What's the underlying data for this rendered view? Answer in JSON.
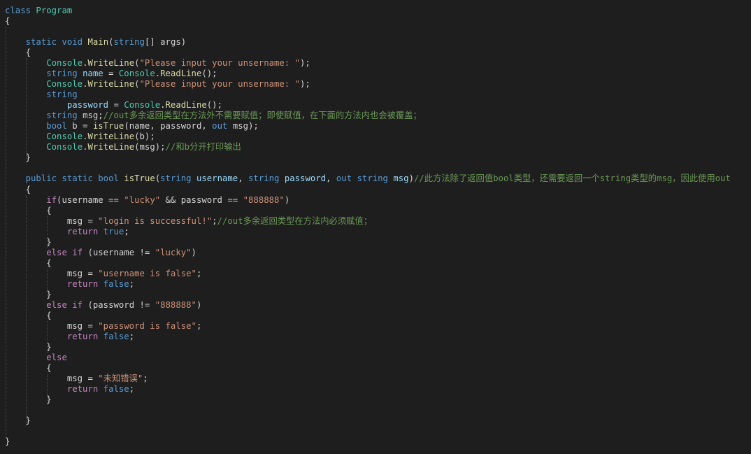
{
  "theme": {
    "background": "#1e1e1e",
    "keyword": "#569cd6",
    "control": "#c586c0",
    "type": "#4ec9b0",
    "method": "#dcdcaa",
    "string": "#ce9178",
    "variable": "#9cdcfe",
    "comment": "#6a9955",
    "plain": "#d4d4d4"
  },
  "code": {
    "lines": [
      {
        "tokens": [
          {
            "t": "class ",
            "c": "kw"
          },
          {
            "t": "Program",
            "c": "ty"
          }
        ]
      },
      {
        "tokens": [
          {
            "t": "{",
            "c": "pl"
          }
        ]
      },
      {
        "tokens": []
      },
      {
        "tokens": [
          {
            "t": "    ",
            "c": "pl"
          },
          {
            "t": "static ",
            "c": "kw"
          },
          {
            "t": "void ",
            "c": "kw"
          },
          {
            "t": "Main",
            "c": "mt"
          },
          {
            "t": "(",
            "c": "pl"
          },
          {
            "t": "string",
            "c": "kw"
          },
          {
            "t": "[] ",
            "c": "pl"
          },
          {
            "t": "args",
            "c": "pl"
          },
          {
            "t": ")",
            "c": "pl"
          }
        ]
      },
      {
        "tokens": [
          {
            "t": "    {",
            "c": "pl"
          }
        ]
      },
      {
        "tokens": [
          {
            "t": "        ",
            "c": "pl"
          },
          {
            "t": "Console",
            "c": "ty"
          },
          {
            "t": ".",
            "c": "pl"
          },
          {
            "t": "WriteLine",
            "c": "mt"
          },
          {
            "t": "(",
            "c": "pl"
          },
          {
            "t": "\"Please input your unsername: \"",
            "c": "st"
          },
          {
            "t": ");",
            "c": "pl"
          }
        ]
      },
      {
        "tokens": [
          {
            "t": "        ",
            "c": "pl"
          },
          {
            "t": "string ",
            "c": "kw"
          },
          {
            "t": "name",
            "c": "va"
          },
          {
            "t": " = ",
            "c": "pl"
          },
          {
            "t": "Console",
            "c": "ty"
          },
          {
            "t": ".",
            "c": "pl"
          },
          {
            "t": "ReadLine",
            "c": "mt"
          },
          {
            "t": "();",
            "c": "pl"
          }
        ]
      },
      {
        "tokens": [
          {
            "t": "        ",
            "c": "pl"
          },
          {
            "t": "Console",
            "c": "ty"
          },
          {
            "t": ".",
            "c": "pl"
          },
          {
            "t": "WriteLine",
            "c": "mt"
          },
          {
            "t": "(",
            "c": "pl"
          },
          {
            "t": "\"Please input your unsername: \"",
            "c": "st"
          },
          {
            "t": ");",
            "c": "pl"
          }
        ]
      },
      {
        "tokens": [
          {
            "t": "        ",
            "c": "pl"
          },
          {
            "t": "string",
            "c": "kw"
          }
        ]
      },
      {
        "tokens": [
          {
            "t": "            ",
            "c": "pl"
          },
          {
            "t": "password",
            "c": "va"
          },
          {
            "t": " = ",
            "c": "pl"
          },
          {
            "t": "Console",
            "c": "ty"
          },
          {
            "t": ".",
            "c": "pl"
          },
          {
            "t": "ReadLine",
            "c": "mt"
          },
          {
            "t": "();",
            "c": "pl"
          }
        ]
      },
      {
        "tokens": [
          {
            "t": "        ",
            "c": "pl"
          },
          {
            "t": "string ",
            "c": "kw"
          },
          {
            "t": "msg;",
            "c": "pl"
          },
          {
            "t": "//out多余返回类型在方法外不需要赋值；即使赋值，在下面的方法内也会被覆盖；",
            "c": "cm"
          }
        ]
      },
      {
        "tokens": [
          {
            "t": "        ",
            "c": "pl"
          },
          {
            "t": "bool ",
            "c": "kw"
          },
          {
            "t": "b = ",
            "c": "pl"
          },
          {
            "t": "isTrue",
            "c": "mt"
          },
          {
            "t": "(name, password, ",
            "c": "pl"
          },
          {
            "t": "out ",
            "c": "kw"
          },
          {
            "t": "msg);",
            "c": "pl"
          }
        ]
      },
      {
        "tokens": [
          {
            "t": "        ",
            "c": "pl"
          },
          {
            "t": "Console",
            "c": "ty"
          },
          {
            "t": ".",
            "c": "pl"
          },
          {
            "t": "WriteLine",
            "c": "mt"
          },
          {
            "t": "(b);",
            "c": "pl"
          }
        ]
      },
      {
        "tokens": [
          {
            "t": "        ",
            "c": "pl"
          },
          {
            "t": "Console",
            "c": "ty"
          },
          {
            "t": ".",
            "c": "pl"
          },
          {
            "t": "WriteLine",
            "c": "mt"
          },
          {
            "t": "(msg);",
            "c": "pl"
          },
          {
            "t": "//和b分开打印输出",
            "c": "cm"
          }
        ]
      },
      {
        "tokens": [
          {
            "t": "    }",
            "c": "pl"
          }
        ]
      },
      {
        "tokens": []
      },
      {
        "tokens": [
          {
            "t": "    ",
            "c": "pl"
          },
          {
            "t": "public ",
            "c": "kw"
          },
          {
            "t": "static ",
            "c": "kw"
          },
          {
            "t": "bool ",
            "c": "kw"
          },
          {
            "t": "isTrue",
            "c": "mt"
          },
          {
            "t": "(",
            "c": "pl"
          },
          {
            "t": "string ",
            "c": "kw"
          },
          {
            "t": "username",
            "c": "va"
          },
          {
            "t": ", ",
            "c": "pl"
          },
          {
            "t": "string ",
            "c": "kw"
          },
          {
            "t": "password",
            "c": "va"
          },
          {
            "t": ", ",
            "c": "pl"
          },
          {
            "t": "out ",
            "c": "kw"
          },
          {
            "t": "string ",
            "c": "kw"
          },
          {
            "t": "msg",
            "c": "va"
          },
          {
            "t": ")",
            "c": "pl"
          },
          {
            "t": "//此方法除了返回值bool类型，还需要返回一个string类型的msg，因此使用out",
            "c": "cm"
          }
        ]
      },
      {
        "tokens": [
          {
            "t": "    {",
            "c": "pl"
          }
        ]
      },
      {
        "tokens": [
          {
            "t": "        ",
            "c": "pl"
          },
          {
            "t": "if",
            "c": "ct"
          },
          {
            "t": "(username == ",
            "c": "pl"
          },
          {
            "t": "\"lucky\"",
            "c": "st"
          },
          {
            "t": " && password == ",
            "c": "pl"
          },
          {
            "t": "\"888888\"",
            "c": "st"
          },
          {
            "t": ")",
            "c": "pl"
          }
        ]
      },
      {
        "tokens": [
          {
            "t": "        {",
            "c": "pl"
          }
        ]
      },
      {
        "tokens": [
          {
            "t": "            msg = ",
            "c": "pl"
          },
          {
            "t": "\"login is successful!\"",
            "c": "st"
          },
          {
            "t": ";",
            "c": "pl"
          },
          {
            "t": "//out多余返回类型在方法内必须赋值；",
            "c": "cm"
          }
        ]
      },
      {
        "tokens": [
          {
            "t": "            ",
            "c": "pl"
          },
          {
            "t": "return ",
            "c": "ct"
          },
          {
            "t": "true",
            "c": "kw"
          },
          {
            "t": ";",
            "c": "pl"
          }
        ]
      },
      {
        "tokens": [
          {
            "t": "        }",
            "c": "pl"
          }
        ]
      },
      {
        "tokens": [
          {
            "t": "        ",
            "c": "pl"
          },
          {
            "t": "else if ",
            "c": "ct"
          },
          {
            "t": "(username != ",
            "c": "pl"
          },
          {
            "t": "\"lucky\"",
            "c": "st"
          },
          {
            "t": ")",
            "c": "pl"
          }
        ]
      },
      {
        "tokens": [
          {
            "t": "        {",
            "c": "pl"
          }
        ]
      },
      {
        "tokens": [
          {
            "t": "            msg = ",
            "c": "pl"
          },
          {
            "t": "\"username is false\"",
            "c": "st"
          },
          {
            "t": ";",
            "c": "pl"
          }
        ]
      },
      {
        "tokens": [
          {
            "t": "            ",
            "c": "pl"
          },
          {
            "t": "return ",
            "c": "ct"
          },
          {
            "t": "false",
            "c": "kw"
          },
          {
            "t": ";",
            "c": "pl"
          }
        ]
      },
      {
        "tokens": [
          {
            "t": "        }",
            "c": "pl"
          }
        ]
      },
      {
        "tokens": [
          {
            "t": "        ",
            "c": "pl"
          },
          {
            "t": "else if ",
            "c": "ct"
          },
          {
            "t": "(password != ",
            "c": "pl"
          },
          {
            "t": "\"888888\"",
            "c": "st"
          },
          {
            "t": ")",
            "c": "pl"
          }
        ]
      },
      {
        "tokens": [
          {
            "t": "        {",
            "c": "pl"
          }
        ]
      },
      {
        "tokens": [
          {
            "t": "            msg = ",
            "c": "pl"
          },
          {
            "t": "\"password is false\"",
            "c": "st"
          },
          {
            "t": ";",
            "c": "pl"
          }
        ]
      },
      {
        "tokens": [
          {
            "t": "            ",
            "c": "pl"
          },
          {
            "t": "return ",
            "c": "ct"
          },
          {
            "t": "false",
            "c": "kw"
          },
          {
            "t": ";",
            "c": "pl"
          }
        ]
      },
      {
        "tokens": [
          {
            "t": "        }",
            "c": "pl"
          }
        ]
      },
      {
        "tokens": [
          {
            "t": "        ",
            "c": "pl"
          },
          {
            "t": "else",
            "c": "ct"
          }
        ]
      },
      {
        "tokens": [
          {
            "t": "        {",
            "c": "pl"
          }
        ]
      },
      {
        "tokens": [
          {
            "t": "            msg = ",
            "c": "pl"
          },
          {
            "t": "\"未知错误\"",
            "c": "st"
          },
          {
            "t": ";",
            "c": "pl"
          }
        ]
      },
      {
        "tokens": [
          {
            "t": "            ",
            "c": "pl"
          },
          {
            "t": "return ",
            "c": "ct"
          },
          {
            "t": "false",
            "c": "kw"
          },
          {
            "t": ";",
            "c": "pl"
          }
        ]
      },
      {
        "tokens": [
          {
            "t": "        }",
            "c": "pl"
          }
        ]
      },
      {
        "tokens": []
      },
      {
        "tokens": [
          {
            "t": "    }",
            "c": "pl"
          }
        ]
      },
      {
        "tokens": []
      },
      {
        "tokens": [
          {
            "t": "}",
            "c": "pl"
          }
        ]
      }
    ]
  }
}
